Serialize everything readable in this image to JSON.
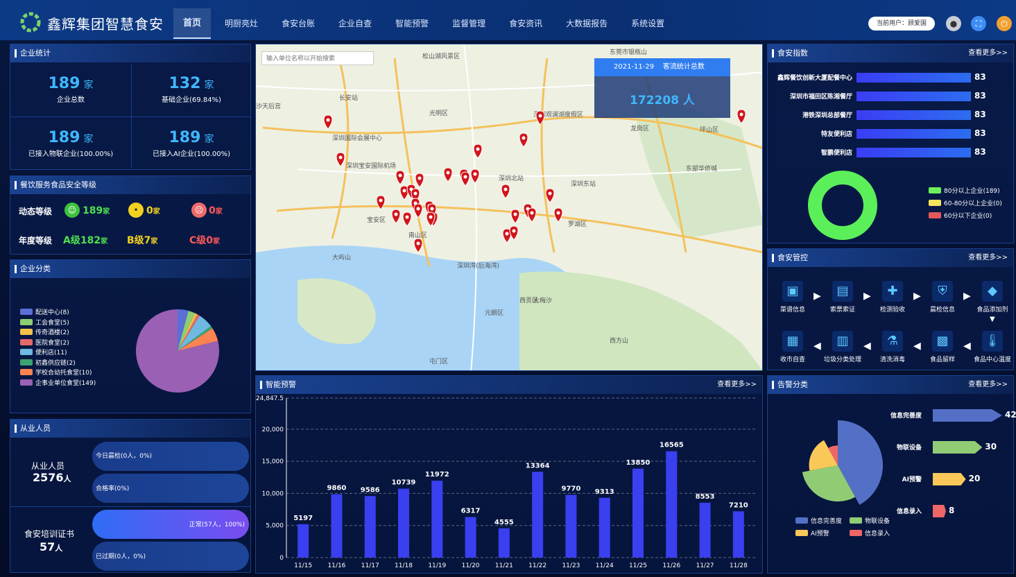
{
  "brand": "鑫辉集团智慧食安",
  "nav": [
    "首页",
    "明厨亮灶",
    "食安台账",
    "企业自查",
    "智能预警",
    "监督管理",
    "食安资讯",
    "大数据报告",
    "系统设置"
  ],
  "user": "当前用户：顾爱国",
  "enterprise": {
    "title": "企业统计",
    "stats": [
      {
        "num": "189",
        "unit": "家",
        "label": "企业总数"
      },
      {
        "num": "132",
        "unit": "家",
        "label": "基础企业(69.84%)"
      },
      {
        "num": "189",
        "unit": "家",
        "label": "已接入物联企业(100.00%)"
      },
      {
        "num": "189",
        "unit": "家",
        "label": "已接入AI企业(100.00%)"
      }
    ]
  },
  "grade": {
    "title": "餐饮服务食品安全等级",
    "dyn_label": "动态等级",
    "year_label": "年度等级",
    "dyn": [
      {
        "v": "189",
        "u": "家"
      },
      {
        "v": "0",
        "u": "家"
      },
      {
        "v": "0",
        "u": "家"
      }
    ],
    "year": [
      {
        "g": "A级",
        "v": "182",
        "u": "家"
      },
      {
        "g": "B级",
        "v": "7",
        "u": "家"
      },
      {
        "g": "C级",
        "v": "0",
        "u": "家"
      }
    ]
  },
  "category": {
    "title": "企业分类",
    "items": [
      {
        "label": "配送中心(8)",
        "value": 8,
        "color": "#5b6fd6"
      },
      {
        "label": "工会食堂(5)",
        "value": 5,
        "color": "#8ccf72"
      },
      {
        "label": "传奇酒楼(2)",
        "value": 2,
        "color": "#f4c24a"
      },
      {
        "label": "医院食堂(2)",
        "value": 2,
        "color": "#e46a6a"
      },
      {
        "label": "便利店(11)",
        "value": 11,
        "color": "#6fb9e0"
      },
      {
        "label": "初鑫供应链(2)",
        "value": 2,
        "color": "#3ba272"
      },
      {
        "label": "学校合幼托食堂(10)",
        "value": 10,
        "color": "#fc8452"
      },
      {
        "label": "企事业单位食堂(149)",
        "value": 149,
        "color": "#9a60b4"
      }
    ]
  },
  "staff": {
    "title": "从业人员",
    "staff_label": "从业人员",
    "staff_num": "2576",
    "staff_unit": "人",
    "train_label": "食安培训证书",
    "train_num": "57",
    "train_unit": "人",
    "pill1": "今日晨检(0人，0%)",
    "pill2": "合格率(0%)",
    "pill3": "正常(57人，100%)",
    "pill4": "已过期(0人，0%)"
  },
  "map": {
    "search_placeholder": "输入单位名称以开始搜索",
    "date": "2021-11-29",
    "stat_label": "客流统计总数",
    "stat_value": "172208 人",
    "places": [
      "松山湖风景区",
      "东莞市银瓶山",
      "深圳国际会展中心",
      "深圳宝安国际机场",
      "深圳北站",
      "深圳东站",
      "深圳观澜湖度假区",
      "龙岗区",
      "坪山区",
      "东部华侨城",
      "宝安区",
      "南山区",
      "深圳湾(后海湾)",
      "罗湖区",
      "大屿山",
      "西贡区",
      "元朗区",
      "西方山",
      "长安站",
      "屯门区",
      "沙天后宫",
      "光明区",
      "大梅沙"
    ]
  },
  "alarm": {
    "title": "智能预警",
    "more": "查看更多>>"
  },
  "chart_data": {
    "type": "bar",
    "categories": [
      "11/15",
      "11/16",
      "11/17",
      "11/18",
      "11/19",
      "11/20",
      "11/21",
      "11/22",
      "11/23",
      "11/24",
      "11/25",
      "11/26",
      "11/27",
      "11/28"
    ],
    "values": [
      5197,
      9860,
      9586,
      10739,
      11972,
      6317,
      4555,
      13364,
      9770,
      9313,
      13850,
      16565,
      8553,
      7210
    ],
    "ylim": [
      0,
      24847.5
    ],
    "yticks": [
      "24,847.5",
      "20,000",
      "15,000",
      "10,000",
      "5,000",
      "0"
    ],
    "grid": true
  },
  "index": {
    "title": "食安指数",
    "more": "查看更多>>",
    "rows": [
      {
        "name": "鑫辉餐饮创新大厦配餐中心",
        "v": "83"
      },
      {
        "name": "深圳市福田区陈湘餐厅",
        "v": "83"
      },
      {
        "name": "港铁深圳总部餐厅",
        "v": "83"
      },
      {
        "name": "特友便利店",
        "v": "83"
      },
      {
        "name": "智鹏便利店",
        "v": "83"
      }
    ],
    "legend": [
      {
        "label": "80分以上企业(189)",
        "color": "#6cf05c"
      },
      {
        "label": "60-80分以上企业(0)",
        "color": "#f6e45c"
      },
      {
        "label": "60分以下企业(0)",
        "color": "#e5585a"
      }
    ]
  },
  "control": {
    "title": "食安管控",
    "more": "查看更多>>",
    "row1": [
      "菜谱信息",
      "索票索证",
      "检测验收",
      "晨检信息",
      "食品添加剂"
    ],
    "row2": [
      "收市自查",
      "垃圾分类处理",
      "清洗消毒",
      "食品留样",
      "食品中心温度"
    ]
  },
  "warn": {
    "title": "告警分类",
    "more": "查看更多>>",
    "items": [
      {
        "label": "信息完善度",
        "value": 42,
        "color": "#5470c6"
      },
      {
        "label": "物联设备",
        "value": 30,
        "color": "#91cc75"
      },
      {
        "label": "AI预警",
        "value": 20,
        "color": "#fac858"
      },
      {
        "label": "信息录入",
        "value": 8,
        "color": "#ee6666"
      }
    ]
  }
}
